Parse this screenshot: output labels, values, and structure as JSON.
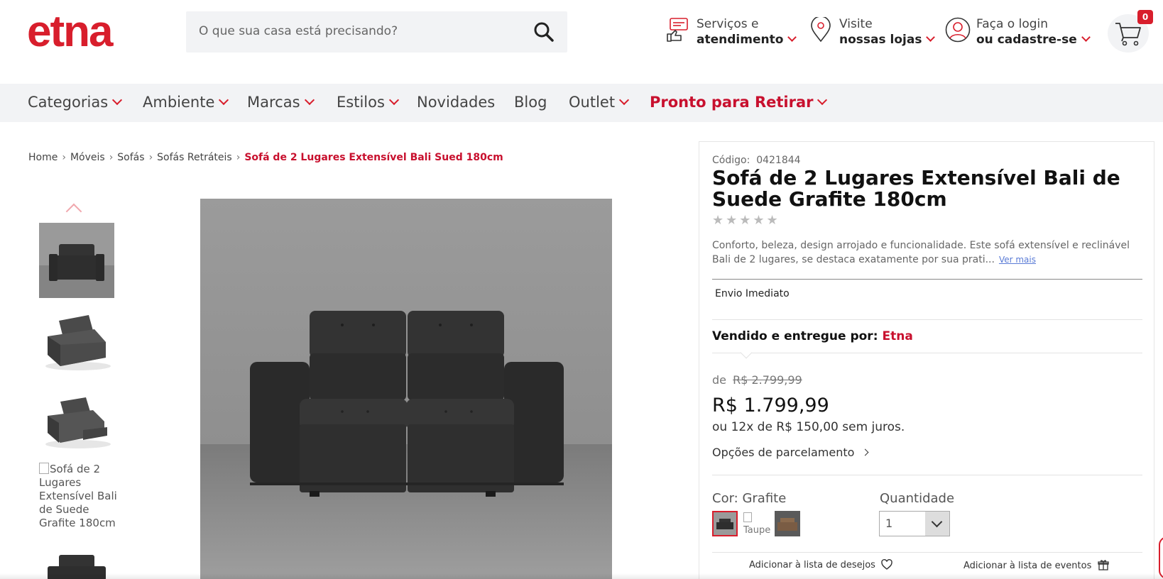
{
  "header": {
    "logo_text": "etna",
    "search_placeholder": "O que sua casa está precisando?",
    "services": {
      "line1": "Serviços e",
      "line2": "atendimento"
    },
    "stores": {
      "line1": "Visite",
      "line2": "nossas lojas"
    },
    "login": {
      "line1": "Faça o login",
      "line2": "ou cadastre-se"
    },
    "cart_count": "0"
  },
  "nav": {
    "items": [
      {
        "label": "Categorias",
        "dropdown": true
      },
      {
        "label": "Ambiente",
        "dropdown": true
      },
      {
        "label": "Marcas",
        "dropdown": true
      },
      {
        "label": "Estilos",
        "dropdown": true
      },
      {
        "label": "Novidades",
        "dropdown": false
      },
      {
        "label": "Blog",
        "dropdown": false
      },
      {
        "label": "Outlet",
        "dropdown": true
      },
      {
        "label": "Pronto para Retirar",
        "dropdown": true
      }
    ]
  },
  "breadcrumb": {
    "items": [
      "Home",
      "Móveis",
      "Sofás",
      "Sofás Retráteis"
    ],
    "current": "Sofá de 2 Lugares Extensível Bali Sued 180cm"
  },
  "gallery": {
    "broken_thumb_alt": "Sofá de 2 Lugares Extensível Bali de Suede Grafite 180cm"
  },
  "product": {
    "code_label": "Código:",
    "code": "0421844",
    "title": "Sofá de 2 Lugares Extensível Bali de Suede Grafite 180cm",
    "rating_stars": "★★★★★",
    "description": "Conforto, beleza, design arrojado e funcionalidade. Este sofá extensível e reclinável Bali de 2 lugares, se destaca exatamente por sua prati...",
    "see_more": "Ver mais",
    "shipping": "Envio Imediato",
    "sold_by_label": "Vendido e entregue por:",
    "seller": "Etna",
    "old_price_label": "de",
    "old_price": "R$ 2.799,99",
    "price": "R$ 1.799,99",
    "installments": "ou 12x de R$ 150,00 sem juros.",
    "installment_options": "Opções de parcelamento",
    "color_label": "Cor: Grafite",
    "color_alt_broken": "Taupe",
    "quantity_label": "Quantidade",
    "quantity_value": "1",
    "wishlist": "Adicionar à lista de desejos",
    "events": "Adicionar à lista de eventos"
  },
  "colors": {
    "brand_red": "#d81e2c",
    "sofa": "#2f2f2f"
  }
}
